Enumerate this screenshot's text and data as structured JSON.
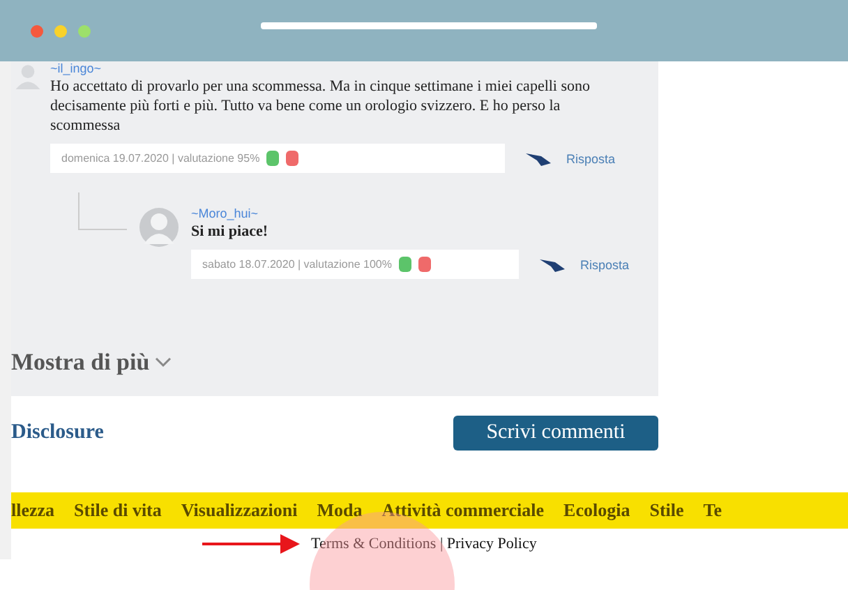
{
  "comments": [
    {
      "author": "~il_ingo~",
      "text": "Ho accettato di provarlo per una scommessa. Ma in cinque settimane i miei capelli sono decisamente più forti e più. Tutto va bene come un orologio svizzero. E ho perso la scommessa",
      "meta": "domenica 19.07.2020 | valutazione 95%",
      "reply_label": "Risposta",
      "replies": [
        {
          "author": "~Moro_hui~",
          "text": "Si mi piace!",
          "meta": "sabato 18.07.2020 | valutazione 100%",
          "reply_label": "Risposta"
        }
      ]
    }
  ],
  "show_more": "Mostra di più",
  "disclosure": "Disclosure",
  "write_button": "Scrivi commenti",
  "categories": [
    "llezza",
    "Stile di vita",
    "Visualizzazioni",
    "Moda",
    "Attività commerciale",
    "Ecologia",
    "Stile",
    "Te"
  ],
  "footer": {
    "terms": "Terms & Conditions",
    "separator": "|",
    "privacy": "Privacy Policy"
  }
}
